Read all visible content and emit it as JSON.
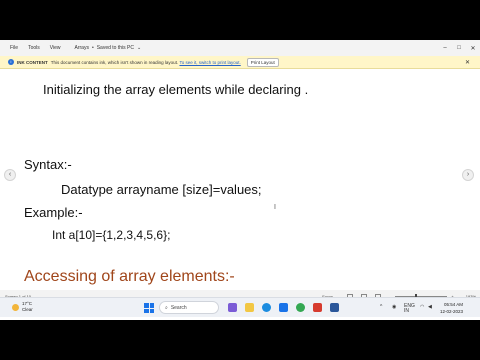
{
  "menubar": {
    "items": [
      "File",
      "Tools",
      "View"
    ],
    "doc_title": "Arrays",
    "save_status": "Saved to this PC",
    "window_controls": [
      "minimize-icon",
      "maximize-icon",
      "close-icon"
    ]
  },
  "infobar": {
    "label": "INK CONTENT",
    "message": "This document contains ink, which isn't shown in reading layout.",
    "link": "To see it, switch to print layout.",
    "button": "Print Layout",
    "close": "✕"
  },
  "document": {
    "line1": "Initializing the array elements while declaring .",
    "syntax_label": "Syntax:-",
    "syntax_line": "Datatype arrayname [size]=values;",
    "example_label": "Example:-",
    "example_line": "Int a[10]={1,2,3,4,5,6};",
    "heading": "Accessing of array elements:-"
  },
  "statusbar": {
    "page": "Screen 1 of 10",
    "focus": "Focus",
    "zoom": "193%"
  },
  "taskbar": {
    "weather_temp": "17°C",
    "weather_desc": "Clear",
    "search_placeholder": "Search",
    "lang": "ENG",
    "region": "IN",
    "time": "05:54 AM",
    "date": "12-02-2023"
  },
  "colors": {
    "heading": "#a0461b",
    "infobar_bg": "#fff6c8",
    "link": "#2563c9"
  }
}
